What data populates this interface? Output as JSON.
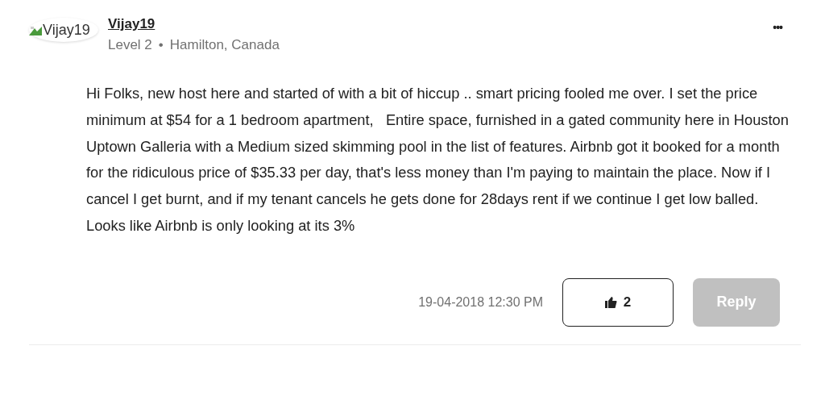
{
  "post": {
    "avatar_alt": "Vijay19",
    "author": "Vijay19",
    "rank": "Level 2",
    "separator": "•",
    "location": "Hamilton, Canada",
    "menu": "•••",
    "body": "Hi Folks, new host here and started of with a bit of hiccup .. smart pricing fooled me over. I set the price minimum at $54 for a 1 bedroom apartment,   Entire space, furnished in a gated community here in Houston Uptown Galleria with a Medium sized skimming pool in the list of features. Airbnb got it booked for a month for the ridiculous price of $35.33 per day, that's less money than I'm paying to maintain the place. Now if I cancel I get burnt, and if my tenant cancels he gets done for 28days rent if we continue I get low balled. Looks like Airbnb is only looking at its 3%",
    "timestamp": "19-04-2018 12:30 PM",
    "kudos": "2",
    "reply": {
      "label": "Reply",
      "disabled": true
    }
  }
}
